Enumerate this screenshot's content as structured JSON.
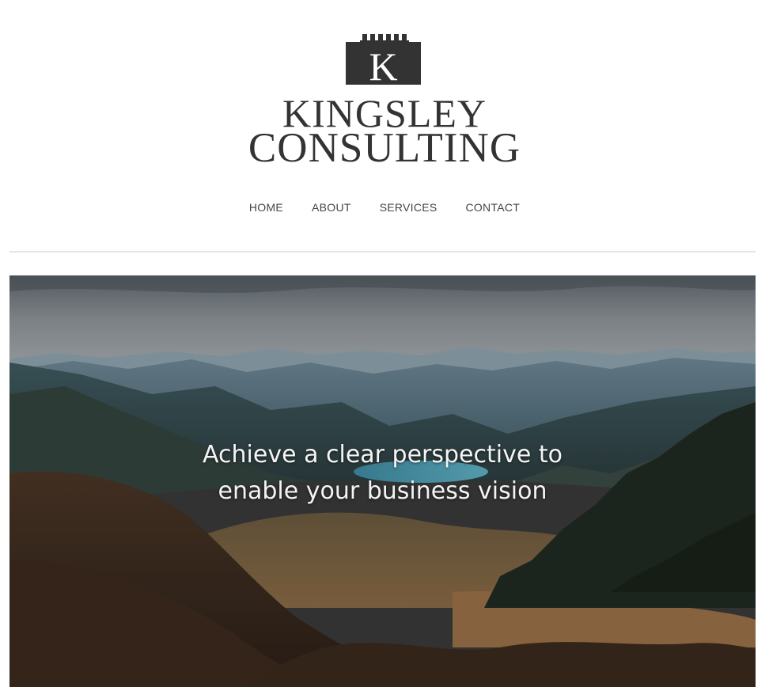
{
  "brand": {
    "logo_letter": "K",
    "line1": "KINGSLEY",
    "line2": "CONSULTING"
  },
  "nav": {
    "items": [
      {
        "label": "HOME"
      },
      {
        "label": "ABOUT"
      },
      {
        "label": "SERVICES"
      },
      {
        "label": "CONTACT"
      }
    ]
  },
  "hero": {
    "headline_line1": "Achieve a clear perspective to",
    "headline_line2": "enable your business vision"
  },
  "colors": {
    "brand_text": "#333333",
    "nav_text": "#444444",
    "divider": "#e4e4e4",
    "hero_text": "#f4f4f4"
  }
}
